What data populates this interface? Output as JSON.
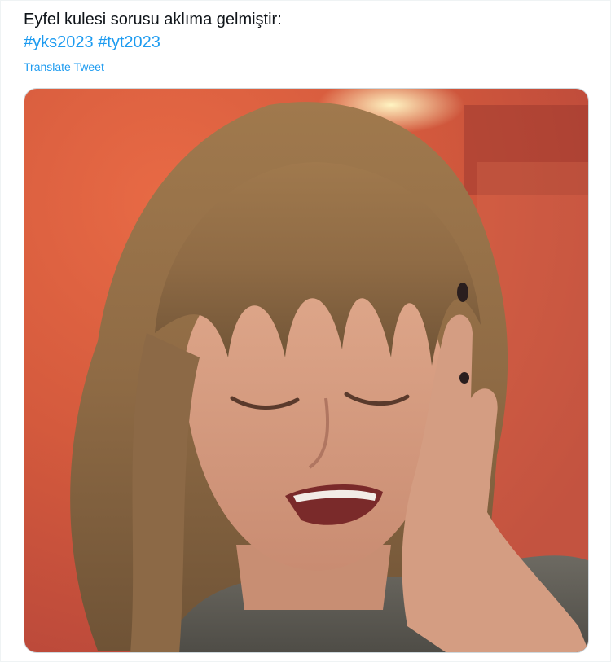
{
  "tweet": {
    "text": "Eyfel kulesi sorusu aklıma gelmiştir:",
    "hashtags": [
      "#yks2023",
      "#tyt2023"
    ],
    "translate_label": "Translate Tweet"
  },
  "media": {
    "type": "photo",
    "icon": "photo-icon"
  },
  "colors": {
    "text": "#0f1419",
    "link": "#1d9bf0",
    "border": "#cfd9de"
  }
}
